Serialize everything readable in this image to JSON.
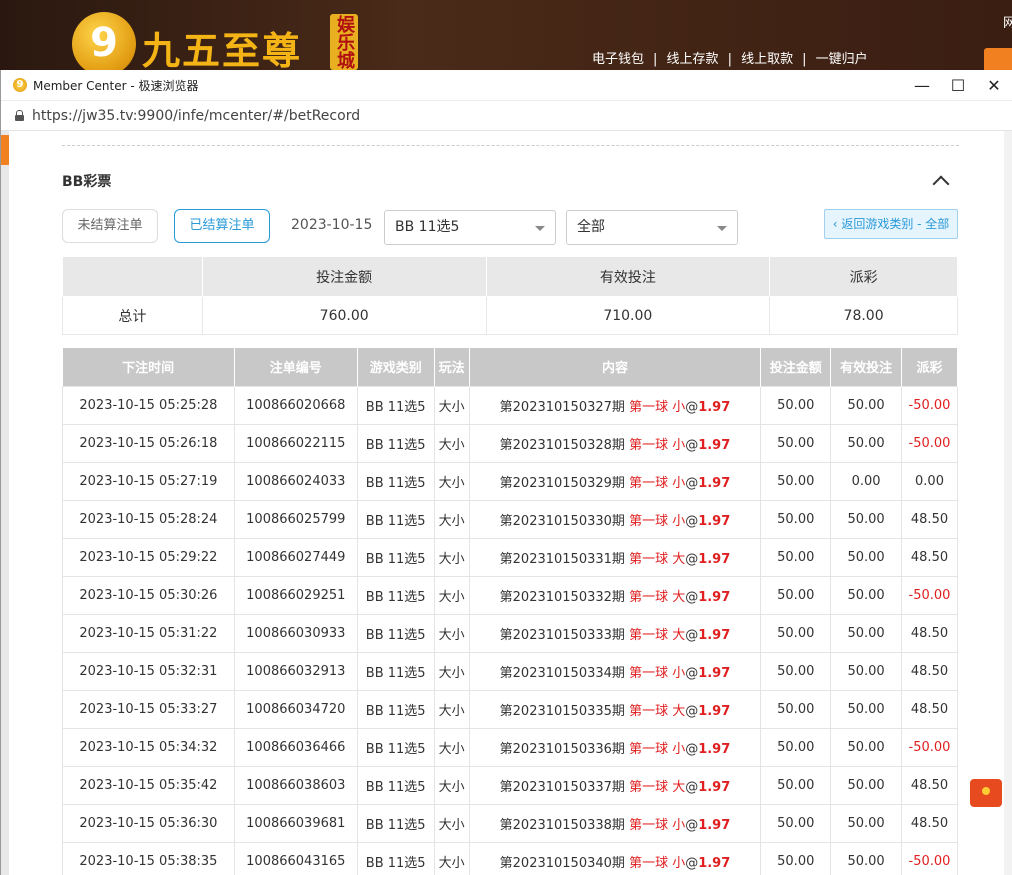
{
  "site": {
    "logo_digit": "9",
    "brand": "九五至尊",
    "badge": "娱乐城",
    "links": [
      "电子钱包",
      "线上存款",
      "线上取款",
      "一键归户"
    ],
    "right_edge": "网"
  },
  "browser": {
    "title": "Member Center - 极速浏览器",
    "url": "https://jw35.tv:9900/infe/mcenter/#/betRecord",
    "controls": {
      "min": "—",
      "max": "☐",
      "close": "✕"
    }
  },
  "section": {
    "title": "BB彩票"
  },
  "filters": {
    "unsettled": "未结算注单",
    "settled": "已结算注单",
    "date": "2023-10-15",
    "game": "BB 11选5",
    "type": "全部",
    "back": "‹ 返回游戏类别 - 全部"
  },
  "summary": {
    "headers": [
      "",
      "投注金额",
      "有效投注",
      "派彩"
    ],
    "row_label": "总计",
    "bet_amount": "760.00",
    "valid_bet": "710.00",
    "payout": "78.00"
  },
  "records": {
    "headers": [
      "下注时间",
      "注单编号",
      "游戏类别",
      "玩法",
      "内容",
      "投注金额",
      "有效投注",
      "派彩"
    ],
    "rows": [
      {
        "time": "2023-10-15 05:25:28",
        "id": "100866020668",
        "game": "BB 11选5",
        "play": "大小",
        "issue": "第202310150327期",
        "ball": "第一球 小",
        "odds": "1.97",
        "bet": "50.00",
        "valid": "50.00",
        "payout": "-50.00",
        "neg": true
      },
      {
        "time": "2023-10-15 05:26:18",
        "id": "100866022115",
        "game": "BB 11选5",
        "play": "大小",
        "issue": "第202310150328期",
        "ball": "第一球 小",
        "odds": "1.97",
        "bet": "50.00",
        "valid": "50.00",
        "payout": "-50.00",
        "neg": true
      },
      {
        "time": "2023-10-15 05:27:19",
        "id": "100866024033",
        "game": "BB 11选5",
        "play": "大小",
        "issue": "第202310150329期",
        "ball": "第一球 小",
        "odds": "1.97",
        "bet": "50.00",
        "valid": "0.00",
        "payout": "0.00",
        "neg": false
      },
      {
        "time": "2023-10-15 05:28:24",
        "id": "100866025799",
        "game": "BB 11选5",
        "play": "大小",
        "issue": "第202310150330期",
        "ball": "第一球 小",
        "odds": "1.97",
        "bet": "50.00",
        "valid": "50.00",
        "payout": "48.50",
        "neg": false
      },
      {
        "time": "2023-10-15 05:29:22",
        "id": "100866027449",
        "game": "BB 11选5",
        "play": "大小",
        "issue": "第202310150331期",
        "ball": "第一球 大",
        "odds": "1.97",
        "bet": "50.00",
        "valid": "50.00",
        "payout": "48.50",
        "neg": false
      },
      {
        "time": "2023-10-15 05:30:26",
        "id": "100866029251",
        "game": "BB 11选5",
        "play": "大小",
        "issue": "第202310150332期",
        "ball": "第一球 大",
        "odds": "1.97",
        "bet": "50.00",
        "valid": "50.00",
        "payout": "-50.00",
        "neg": true
      },
      {
        "time": "2023-10-15 05:31:22",
        "id": "100866030933",
        "game": "BB 11选5",
        "play": "大小",
        "issue": "第202310150333期",
        "ball": "第一球 大",
        "odds": "1.97",
        "bet": "50.00",
        "valid": "50.00",
        "payout": "48.50",
        "neg": false
      },
      {
        "time": "2023-10-15 05:32:31",
        "id": "100866032913",
        "game": "BB 11选5",
        "play": "大小",
        "issue": "第202310150334期",
        "ball": "第一球 小",
        "odds": "1.97",
        "bet": "50.00",
        "valid": "50.00",
        "payout": "48.50",
        "neg": false
      },
      {
        "time": "2023-10-15 05:33:27",
        "id": "100866034720",
        "game": "BB 11选5",
        "play": "大小",
        "issue": "第202310150335期",
        "ball": "第一球 大",
        "odds": "1.97",
        "bet": "50.00",
        "valid": "50.00",
        "payout": "48.50",
        "neg": false
      },
      {
        "time": "2023-10-15 05:34:32",
        "id": "100866036466",
        "game": "BB 11选5",
        "play": "大小",
        "issue": "第202310150336期",
        "ball": "第一球 小",
        "odds": "1.97",
        "bet": "50.00",
        "valid": "50.00",
        "payout": "-50.00",
        "neg": true
      },
      {
        "time": "2023-10-15 05:35:42",
        "id": "100866038603",
        "game": "BB 11选5",
        "play": "大小",
        "issue": "第202310150337期",
        "ball": "第一球 大",
        "odds": "1.97",
        "bet": "50.00",
        "valid": "50.00",
        "payout": "48.50",
        "neg": false
      },
      {
        "time": "2023-10-15 05:36:30",
        "id": "100866039681",
        "game": "BB 11选5",
        "play": "大小",
        "issue": "第202310150338期",
        "ball": "第一球 小",
        "odds": "1.97",
        "bet": "50.00",
        "valid": "50.00",
        "payout": "48.50",
        "neg": false
      },
      {
        "time": "2023-10-15 05:38:35",
        "id": "100866043165",
        "game": "BB 11选5",
        "play": "大小",
        "issue": "第202310150340期",
        "ball": "第一球 小",
        "odds": "1.97",
        "bet": "50.00",
        "valid": "50.00",
        "payout": "-50.00",
        "neg": true
      }
    ]
  },
  "colors": {
    "accent": "#2a9ad8",
    "negative": "#e02020",
    "brand_gold": "#f4b416"
  },
  "icons": {
    "app": "app-logo-icon",
    "lock": "lock-icon",
    "collapse": "chevron-up-icon",
    "dropdown": "caret-down-icon",
    "float": "red-envelope-icon"
  }
}
